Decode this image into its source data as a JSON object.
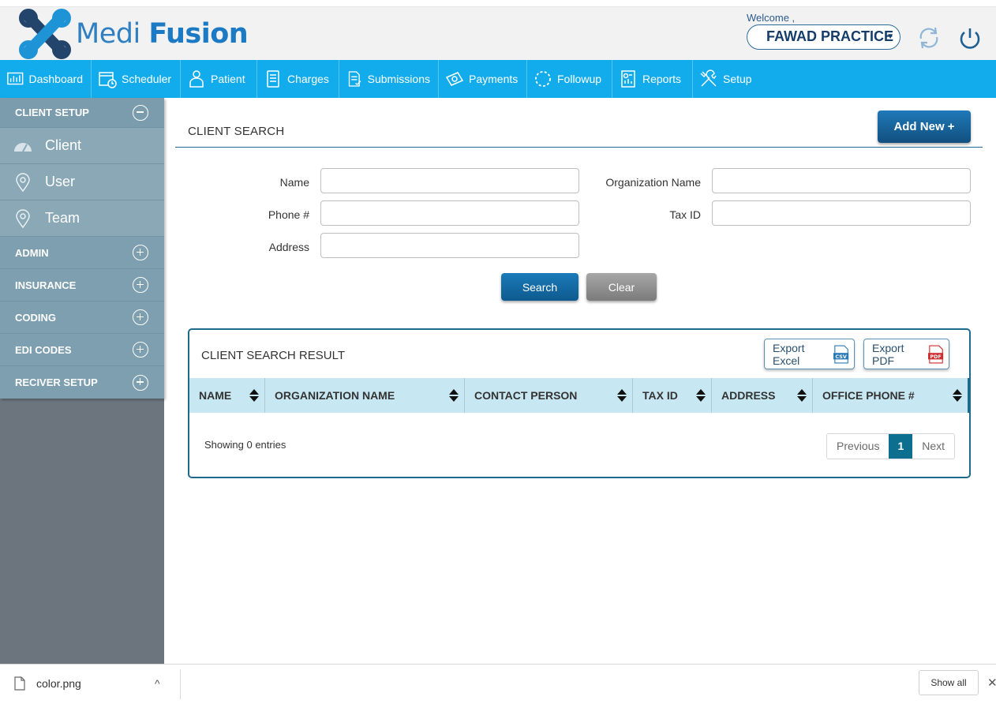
{
  "header": {
    "logo_part1": "Medi",
    "logo_part2": "Fusion",
    "welcome_label": "Welcome ,",
    "practice_name": "FAWAD PRACTICE",
    "refresh_icon": "refresh-icon",
    "power_icon": "power-icon"
  },
  "nav": {
    "items": [
      {
        "label": "Dashboard",
        "icon": "dashboard-icon"
      },
      {
        "label": "Scheduler",
        "icon": "calendar-icon"
      },
      {
        "label": "Patient",
        "icon": "patient-icon"
      },
      {
        "label": "Charges",
        "icon": "document-icon"
      },
      {
        "label": "Submissions",
        "icon": "submission-icon"
      },
      {
        "label": "Payments",
        "icon": "money-icon"
      },
      {
        "label": "Followup",
        "icon": "followup-icon"
      },
      {
        "label": "Reports",
        "icon": "report-icon"
      },
      {
        "label": "Setup",
        "icon": "tools-icon"
      }
    ]
  },
  "sidebar": {
    "client_setup": "CLIENT SETUP",
    "subitems": [
      {
        "label": "Client",
        "icon": "speedometer-icon"
      },
      {
        "label": "User",
        "icon": "map-pin-icon"
      },
      {
        "label": "Team",
        "icon": "map-pin-icon"
      }
    ],
    "sections": [
      "ADMIN",
      "INSURANCE",
      "CODING",
      "EDI CODES",
      "RECIVER SETUP"
    ]
  },
  "main": {
    "title": "CLIENT SEARCH",
    "add_new": "Add New +",
    "form": {
      "name_label": "Name",
      "org_label": "Organization Name",
      "phone_label": "Phone #",
      "taxid_label": "Tax ID",
      "address_label": "Address",
      "name_value": "",
      "org_value": "",
      "phone_value": "",
      "taxid_value": "",
      "address_value": ""
    },
    "search_btn": "Search",
    "clear_btn": "Clear"
  },
  "results": {
    "title": "CLIENT SEARCH RESULT",
    "export_excel": "Export Excel",
    "export_pdf": "Export PDF",
    "excel_badge": "CSV",
    "pdf_badge": "PDF",
    "columns": [
      "NAME",
      "ORGANIZATION NAME",
      "CONTACT PERSON",
      "TAX ID",
      "ADDRESS",
      "OFFICE PHONE #"
    ],
    "rows": [],
    "showing": "Showing 0 entries",
    "pagination": {
      "previous": "Previous",
      "current": "1",
      "next": "Next"
    }
  },
  "download_bar": {
    "file_name": "color.png",
    "chevron": "^",
    "show_all": "Show all",
    "close": "✕"
  },
  "colors": {
    "nav_bg": "#12acec",
    "sidebar_panel": "#7fa1b2",
    "primary_button": "#11507f",
    "table_header": "#c7e8f2",
    "active_page": "#0c6f8f"
  }
}
